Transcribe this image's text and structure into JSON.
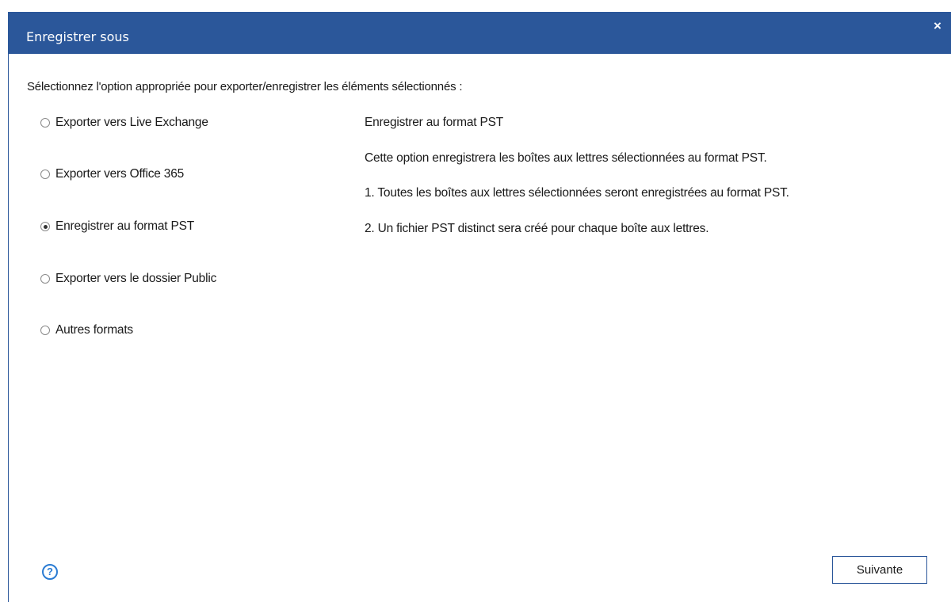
{
  "dialog": {
    "title": "Enregistrer sous",
    "close_label": "×"
  },
  "instruction": "Sélectionnez l'option appropriée pour exporter/enregistrer les éléments sélectionnés :",
  "options": [
    {
      "label": "Exporter vers Live Exchange",
      "selected": false
    },
    {
      "label": "Exporter vers Office 365",
      "selected": false
    },
    {
      "label": "Enregistrer au format PST",
      "selected": true
    },
    {
      "label": "Exporter vers le dossier Public",
      "selected": false
    },
    {
      "label": "Autres formats",
      "selected": false
    }
  ],
  "description": {
    "heading": "Enregistrer au format PST",
    "summary": "Cette option enregistrera les boîtes aux lettres sélectionnées au format PST.",
    "point1": "1. Toutes les boîtes aux lettres sélectionnées seront enregistrées au format PST.",
    "point2": "2. Un fichier PST distinct sera créé pour chaque boîte aux lettres."
  },
  "footer": {
    "help_label": "?",
    "next_label": "Suivante"
  },
  "colors": {
    "accent": "#2b579a",
    "help": "#2b7cd3"
  }
}
